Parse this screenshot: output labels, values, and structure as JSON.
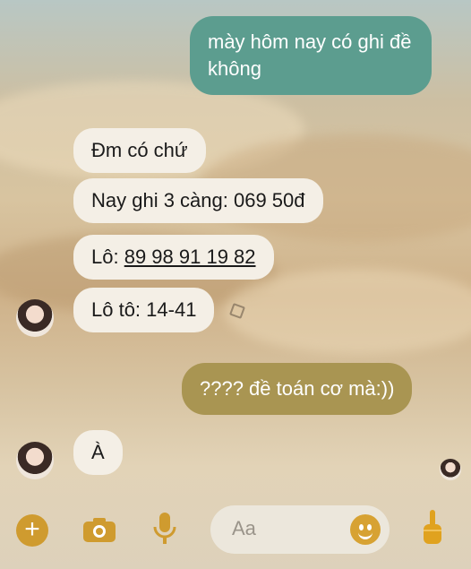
{
  "messages": [
    {
      "dir": "out",
      "text": "mày hôm nay có ghi đề không"
    },
    {
      "dir": "in",
      "text": "Đm có chứ"
    },
    {
      "dir": "in",
      "text": "Nay ghi 3 càng: 069 50đ"
    },
    {
      "dir": "in",
      "prefix": "Lô: ",
      "numbers": "89 98 91 19 82"
    },
    {
      "dir": "in",
      "text": "Lô tô: 14-41"
    },
    {
      "dir": "out",
      "text": "???? đề toán cơ mà:))"
    },
    {
      "dir": "in",
      "text": "À"
    }
  ],
  "composer": {
    "placeholder": "Aa",
    "icons": [
      "plus-icon",
      "camera-icon",
      "microphone-icon",
      "emoji-icon",
      "thumbs-up-icon"
    ]
  },
  "colors": {
    "outgoing_1": "#5c9d8f",
    "outgoing_2": "#a99552",
    "incoming": "#f4efe6",
    "accent": "#cf9b2f"
  }
}
